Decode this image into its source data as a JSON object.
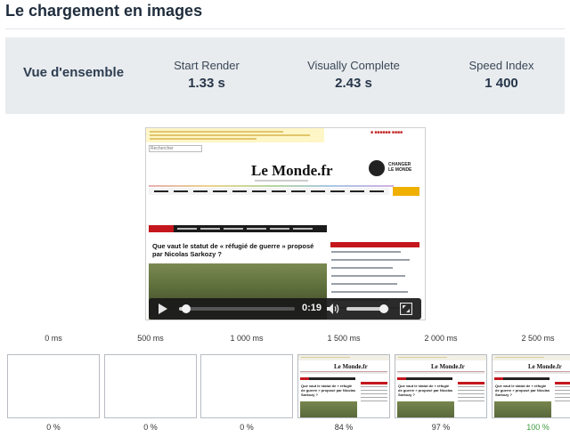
{
  "page": {
    "title": "Le chargement en images"
  },
  "summary": {
    "overview_label": "Vue d'ensemble",
    "metrics": [
      {
        "label": "Start Render",
        "value": "1.33 s"
      },
      {
        "label": "Visually Complete",
        "value": "2.43 s"
      },
      {
        "label": "Speed Index",
        "value": "1 400"
      }
    ]
  },
  "video": {
    "time": "0:19",
    "progress_fraction": 0.04,
    "volume_fraction": 0.9,
    "frame": {
      "search_placeholder": "Rechercher",
      "logo": "Le Monde.fr",
      "badge_text": "CHANGER LE MONDE",
      "headline": "Que vaut le statut de « réfugié de guerre » proposé par Nicolas Sarkozy ?"
    }
  },
  "filmstrip": {
    "frames": [
      {
        "time": "0 ms",
        "completeness": "0 %",
        "rendered": false
      },
      {
        "time": "500 ms",
        "completeness": "0 %",
        "rendered": false
      },
      {
        "time": "1 000 ms",
        "completeness": "0 %",
        "rendered": false
      },
      {
        "time": "1 500 ms",
        "completeness": "84 %",
        "rendered": true
      },
      {
        "time": "2 000 ms",
        "completeness": "97 %",
        "rendered": true
      },
      {
        "time": "2 500 ms",
        "completeness": "100 %",
        "rendered": true
      }
    ]
  },
  "colors": {
    "complete_green": "#3d9a3d",
    "summary_bg": "#e9ecef"
  }
}
